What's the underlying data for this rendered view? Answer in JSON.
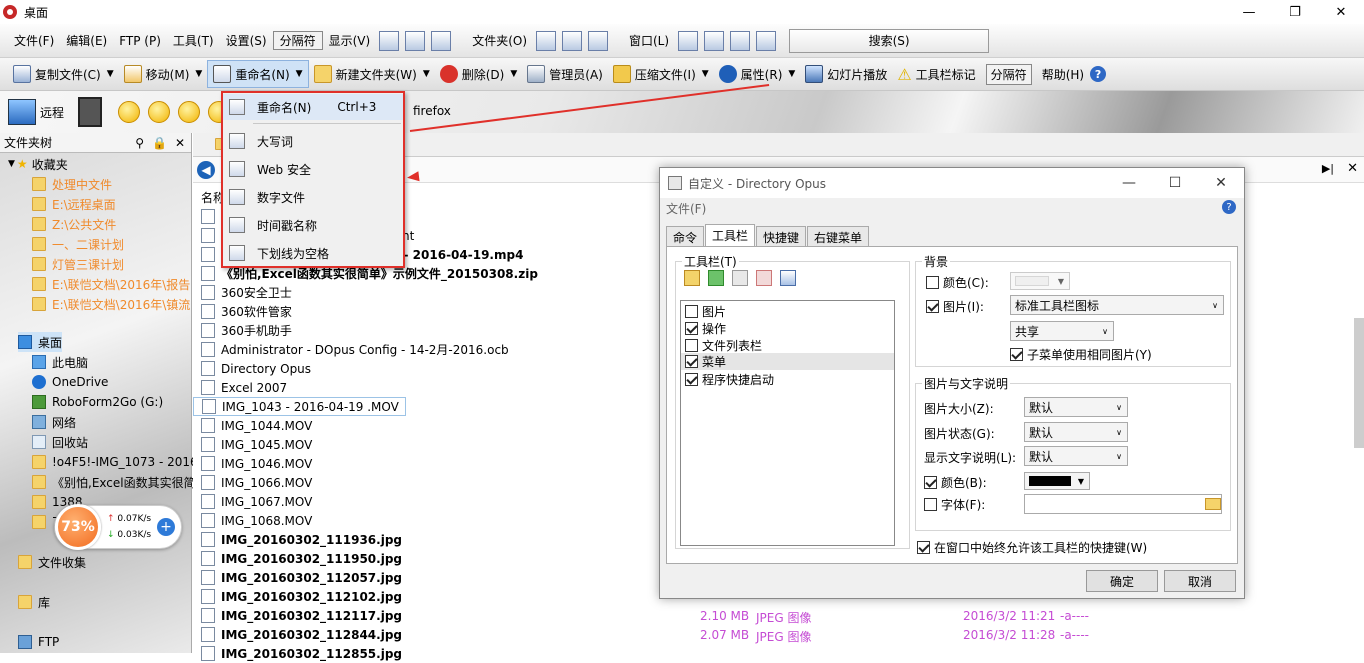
{
  "window": {
    "title": "桌面",
    "min": "—",
    "max": "❐",
    "close": "✕"
  },
  "menubar": {
    "items": [
      "文件(F)",
      "编辑(E)",
      "FTP (P)",
      "工具(T)",
      "设置(S)",
      "分隔符",
      "显示(V)"
    ],
    "folders": "文件夹(O)",
    "window": "窗口(L)",
    "search": "搜索(S)"
  },
  "toolbar": {
    "items": [
      {
        "label": "复制文件(C)",
        "icon": "copy-icon",
        "dd": true
      },
      {
        "label": "移动(M)",
        "icon": "move-icon",
        "dd": true
      },
      {
        "label": "重命名(N)",
        "icon": "rename-icon",
        "dd": true,
        "active": true
      },
      {
        "label": "新建文件夹(W)",
        "icon": "new-folder-icon",
        "dd": true
      },
      {
        "label": "删除(D)",
        "icon": "delete-icon",
        "dd": true
      },
      {
        "label": "管理员(A)",
        "icon": "admin-icon",
        "dd": false
      },
      {
        "label": "压缩文件(I)",
        "icon": "zip-icon",
        "dd": true
      },
      {
        "label": "属性(R)",
        "icon": "info-icon",
        "dd": true
      },
      {
        "label": "幻灯片播放",
        "icon": "slideshow-icon",
        "dd": false
      },
      {
        "label": "工具栏标记",
        "icon": "warning-icon",
        "dd": false
      },
      {
        "label": "分隔符",
        "icon": "",
        "dd": false
      },
      {
        "label": "帮助(H)",
        "icon": "help-icon",
        "dd": false
      }
    ]
  },
  "toolbar3": {
    "remote": "远程",
    "firefox": "firefox"
  },
  "tree": {
    "header": "文件夹树",
    "favorites": "收藏夹",
    "fav_items": [
      "处理中文件",
      "E:\\远程桌面",
      "Z:\\公共文件",
      "一、二课计划",
      "灯管三课计划",
      "E:\\联恺文档\\2016年\\报告",
      "E:\\联恺文档\\2016年\\镇流"
    ],
    "desktop": "桌面",
    "desk_items": [
      "此电脑",
      "OneDrive",
      "RoboForm2Go (G:)",
      "网络",
      "回收站",
      "!o4F5!-IMG_1073 - 2016",
      "《别怕,Excel函数其实很简",
      "1388",
      "7"
    ],
    "collection": "文件收集",
    "library": "库",
    "ftp": "FTP"
  },
  "float_widget": {
    "percent": "73%",
    "up": "0.07K/s",
    "down": "0.03K/s"
  },
  "filepanel": {
    "name_col": "名称",
    "files": [
      {
        "name": "",
        "bold": false
      },
      {
        "name": "0P.MP4]1.88GB[国语中字].torrent",
        "bold": false
      },
      {
        "name": "080P.MP4]1.88GB[国语中字] - 2016-04-19.mp4",
        "bold": true
      },
      {
        "name": "《别怕,Excel函数其实很简单》示例文件_20150308.zip",
        "bold": true
      },
      {
        "name": "360安全卫士",
        "bold": false
      },
      {
        "name": "360软件管家",
        "bold": false
      },
      {
        "name": "360手机助手",
        "bold": false
      },
      {
        "name": "Administrator - DOpus Config - 14-2月-2016.ocb",
        "bold": false
      },
      {
        "name": "Directory Opus",
        "bold": false
      },
      {
        "name": "Excel 2007",
        "bold": false
      },
      {
        "name": "IMG_1043 - 2016-04-19 .MOV",
        "bold": false
      },
      {
        "name": "IMG_1044.MOV",
        "bold": false
      },
      {
        "name": "IMG_1045.MOV",
        "bold": false
      },
      {
        "name": "IMG_1046.MOV",
        "bold": false
      },
      {
        "name": "IMG_1066.MOV",
        "bold": false
      },
      {
        "name": "IMG_1067.MOV",
        "bold": false
      },
      {
        "name": "IMG_1068.MOV",
        "bold": false
      },
      {
        "name": "IMG_20160302_111936.jpg",
        "bold": true
      },
      {
        "name": "IMG_20160302_111950.jpg",
        "bold": true
      },
      {
        "name": "IMG_20160302_112057.jpg",
        "bold": true
      },
      {
        "name": "IMG_20160302_112102.jpg",
        "bold": true
      },
      {
        "name": "IMG_20160302_112117.jpg",
        "bold": true
      },
      {
        "name": "IMG_20160302_112844.jpg",
        "bold": true
      },
      {
        "name": "IMG_20160302_112855.jpg",
        "bold": true
      }
    ],
    "meta_rows": [
      {
        "size": "2.10 MB",
        "type": "JPEG 图像",
        "date": "2016/3/2 11:21",
        "attr": "-a----"
      },
      {
        "size": "2.07 MB",
        "type": "JPEG 图像",
        "date": "2016/3/2 11:28",
        "attr": "-a----"
      }
    ]
  },
  "rename_menu": {
    "items": [
      {
        "label": "重命名(N)",
        "shortcut": "Ctrl+3"
      },
      {
        "label": "大写词",
        "shortcut": ""
      },
      {
        "label": "Web 安全",
        "shortcut": ""
      },
      {
        "label": "数字文件",
        "shortcut": ""
      },
      {
        "label": "时间戳名称",
        "shortcut": ""
      },
      {
        "label": "下划线为空格",
        "shortcut": ""
      }
    ]
  },
  "dialog": {
    "title": "自定义 - Directory Opus",
    "menu": "文件(F)",
    "tabs": [
      "命令",
      "工具栏",
      "快捷键",
      "右键菜单"
    ],
    "toolbars_label": "工具栏(T)",
    "toolbar_list": [
      {
        "label": "图片",
        "checked": false
      },
      {
        "label": "操作",
        "checked": true
      },
      {
        "label": "文件列表栏",
        "checked": false
      },
      {
        "label": "菜单",
        "checked": true
      },
      {
        "label": "程序快捷启动",
        "checked": true
      }
    ],
    "bg_group": "背景",
    "bg_color_label": "颜色(C):",
    "bg_image_label": "图片(I):",
    "bg_image_value": "标准工具栏图标",
    "share_value": "共享",
    "submenu_same": "子菜单使用相同图片(Y)",
    "img_text_group": "图片与文字说明",
    "img_size_label": "图片大小(Z):",
    "img_size_value": "默认",
    "img_state_label": "图片状态(G):",
    "img_state_value": "默认",
    "show_text_label": "显示文字说明(L):",
    "show_text_value": "默认",
    "color_label": "颜色(B):",
    "font_label": "字体(F):",
    "allow_shortcuts": "在窗口中始终允许该工具栏的快捷键(W)",
    "ok": "确定",
    "cancel": "取消"
  }
}
